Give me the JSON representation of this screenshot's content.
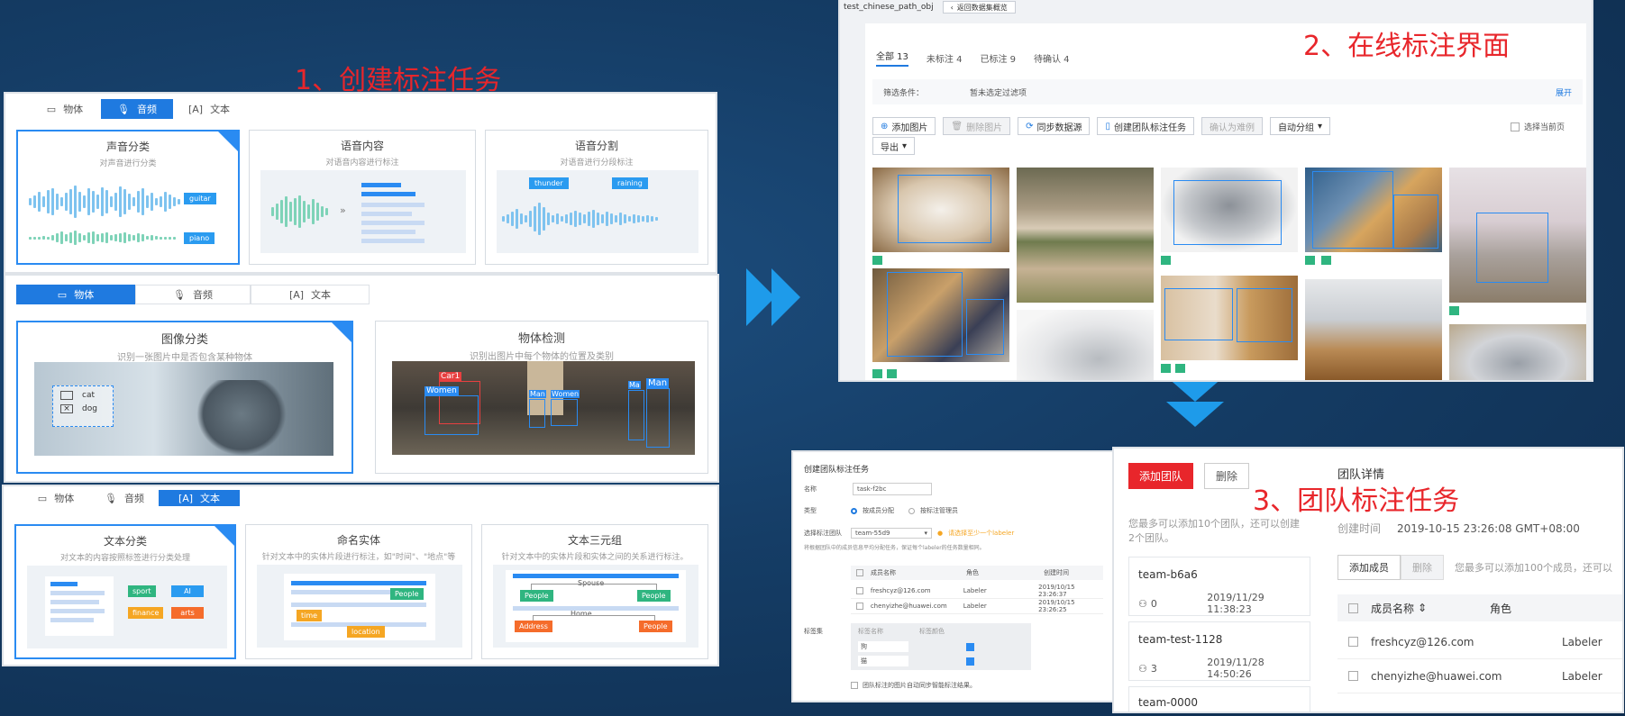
{
  "titles": {
    "create": "1、创建标注任务",
    "online": "2、在线标注界面",
    "team": "3、团队标注任务"
  },
  "audio_panel": {
    "tabs": [
      {
        "label": "物体",
        "icon": "image-icon"
      },
      {
        "label": "音频",
        "icon": "mic-icon"
      },
      {
        "label": "文本",
        "icon": "text-icon"
      }
    ],
    "active_tab": 1,
    "cards": [
      {
        "title": "声音分类",
        "subtitle": "对声音进行分类",
        "labels": [
          "guitar",
          "piano"
        ]
      },
      {
        "title": "语音内容",
        "subtitle": "对语音内容进行标注"
      },
      {
        "title": "语音分割",
        "subtitle": "对语音进行分段标注",
        "labels": [
          "thunder",
          "raining"
        ]
      }
    ]
  },
  "image_panel": {
    "tabs": [
      {
        "label": "物体",
        "icon": "image-icon"
      },
      {
        "label": "音频",
        "icon": "mic-icon"
      },
      {
        "label": "文本",
        "icon": "text-icon"
      }
    ],
    "active_tab": 0,
    "cards": [
      {
        "title": "图像分类",
        "subtitle": "识别一张图片中是否包含某种物体",
        "options": [
          "cat",
          "dog"
        ]
      },
      {
        "title": "物体检测",
        "subtitle": "识别出图片中每个物体的位置及类别",
        "boxes": [
          "Car1",
          "Women",
          "Man",
          "Women",
          "Ma",
          "Man"
        ]
      }
    ]
  },
  "text_panel": {
    "tabs": [
      {
        "label": "物体",
        "icon": "image-icon"
      },
      {
        "label": "音频",
        "icon": "mic-icon"
      },
      {
        "label": "文本",
        "icon": "text-icon"
      }
    ],
    "active_tab": 2,
    "cards": [
      {
        "title": "文本分类",
        "subtitle": "对文本的内容按照标签进行分类处理",
        "chips": [
          "sport",
          "AI",
          "finance",
          "arts"
        ]
      },
      {
        "title": "命名实体",
        "subtitle": "针对文本中的实体片段进行标注，如\"时间\"、\"地点\"等",
        "chips": [
          "People",
          "time",
          "location"
        ]
      },
      {
        "title": "文本三元组",
        "subtitle": "针对文本中的实体片段和实体之间的关系进行标注。",
        "chips": [
          "People",
          "People",
          "Address",
          "People"
        ],
        "relations": [
          "Spouse",
          "Home"
        ]
      }
    ]
  },
  "labeling": {
    "dataset": "test_chinese_path_obj",
    "back": "返回数据集概览",
    "tabs": [
      "全部 13",
      "未标注 4",
      "已标注 9",
      "待确认 4"
    ],
    "filter_label": "筛选条件：",
    "filter_value": "暂未选定过滤项",
    "expand": "展开",
    "buttons": [
      "添加图片",
      "删除图片",
      "同步数据源",
      "创建团队标注任务",
      "确认为难例",
      "自动分组",
      "导出"
    ],
    "select_page": "选择当前页"
  },
  "create_team_form": {
    "title": "创建团队标注任务",
    "name_label": "名称",
    "name_value": "task-f2bc",
    "type_label": "类型",
    "type_options": [
      "按成员分配",
      "按标注管理员"
    ],
    "team_label": "选择标注团队",
    "team_value": "team-55d9",
    "team_hint": "请选择至少一个labeler",
    "note": "将根据团队中的成员信息平均分配任务，保证每个labeler的任务数量相同。",
    "columns": [
      "成员名称",
      "角色",
      "创建时间"
    ],
    "members": [
      {
        "email": "freshcyz@126.com",
        "role": "Labeler",
        "time": "2019/10/15 23:26:37"
      },
      {
        "email": "chenyizhe@huawei.com",
        "role": "Labeler",
        "time": "2019/10/15 23:26:25"
      }
    ],
    "labelset_label": "标签集",
    "labelset_cols": [
      "标签名称",
      "标签颜色"
    ],
    "labelset_items": [
      "狗",
      "猫"
    ],
    "checkbox": "团队标注的图片自动同步智能标注结果。"
  },
  "team_panel": {
    "add_team": "添加团队",
    "delete": "删除",
    "hint": "您最多可以添加10个团队，还可以创建2个团队。",
    "teams": [
      {
        "name": "team-b6a6",
        "members": "0",
        "time": "2019/11/29 11:38:23"
      },
      {
        "name": "team-test-1128",
        "members": "3",
        "time": "2019/11/28 14:50:26"
      },
      {
        "name": "team-0000",
        "members": "",
        "time": ""
      }
    ],
    "details_title": "团队详情",
    "created_label": "创建时间",
    "created_value": "2019-10-15 23:26:08 GMT+08:00",
    "add_member": "添加成员",
    "delete_member": "删除",
    "member_hint": "您最多可以添加100个成员，还可以",
    "columns": [
      "成员名称",
      "角色"
    ],
    "members": [
      {
        "email": "freshcyz@126.com",
        "role": "Labeler"
      },
      {
        "email": "chenyizhe@huawei.com",
        "role": "Labeler"
      }
    ]
  },
  "colors": {
    "accent": "#1f7ae0",
    "title_red": "#e8262b",
    "arrow": "#1e9bea",
    "tag_green": "#2fb580"
  }
}
